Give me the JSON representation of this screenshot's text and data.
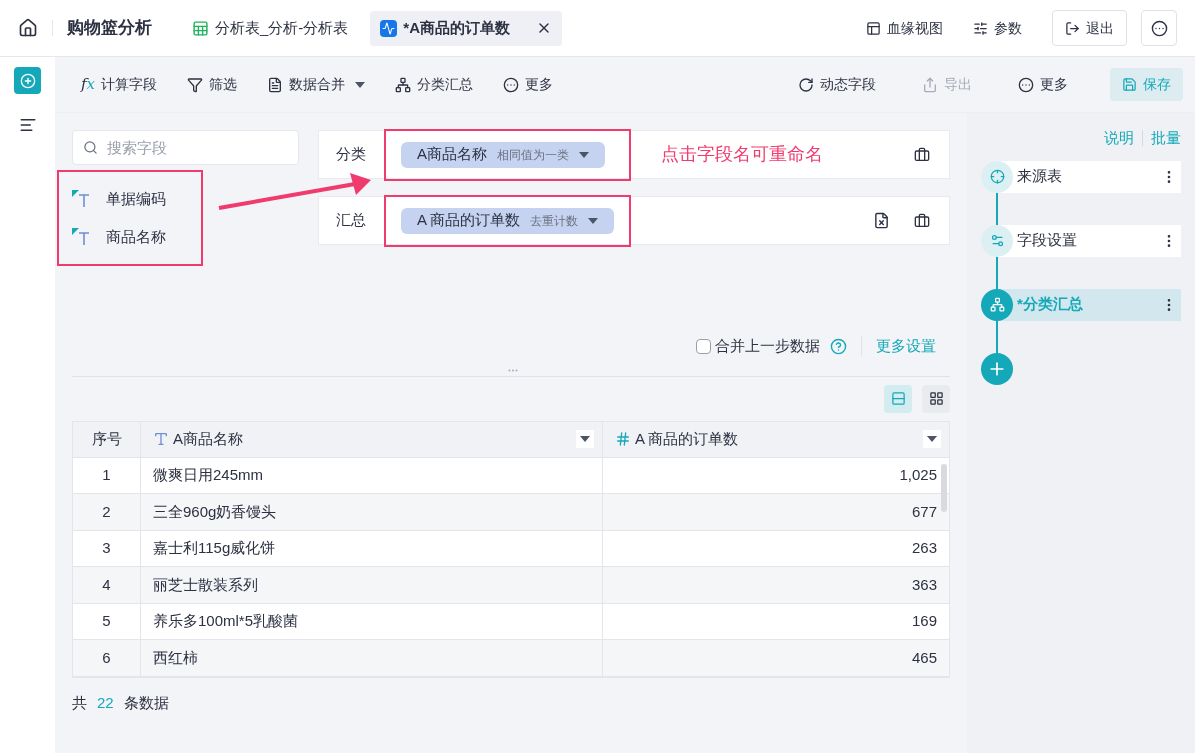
{
  "header": {
    "title": "购物篮分析",
    "tabs": [
      {
        "kind": "sheet",
        "label": "分析表_分析-分析表",
        "selected": false
      },
      {
        "kind": "chart",
        "label": "*A商品的订单数",
        "selected": true
      }
    ],
    "actions": [
      {
        "kind": "lineage",
        "label": "血缘视图"
      },
      {
        "kind": "params",
        "label": "参数"
      }
    ],
    "exit": "退出"
  },
  "toolbar": {
    "left": [
      {
        "kind": "fx",
        "glyph": "fx",
        "label": "计算字段",
        "dropdown": false
      },
      {
        "kind": "filter",
        "label": "筛选",
        "dropdown": false
      },
      {
        "kind": "merge",
        "label": "数据合并",
        "dropdown": true
      },
      {
        "kind": "group",
        "label": "分类汇总",
        "dropdown": false
      },
      {
        "kind": "more",
        "label": "更多",
        "dropdown": false
      }
    ],
    "right": [
      {
        "kind": "dynamic",
        "label": "动态字段",
        "disabled": false
      },
      {
        "kind": "export",
        "label": "导出",
        "disabled": true
      },
      {
        "kind": "more",
        "label": "更多",
        "disabled": false
      }
    ],
    "save": "保存"
  },
  "search": {
    "placeholder": "搜索字段"
  },
  "fields": [
    "单据编码",
    "商品名称"
  ],
  "config": [
    {
      "label": "分类",
      "chip": "A商品名称",
      "mode": "相同值为一类",
      "clearable": false
    },
    {
      "label": "汇总",
      "chip": "A 商品的订单数",
      "mode": "去重计数",
      "clearable": true
    }
  ],
  "hint": "点击字段名可重命名",
  "merge": {
    "label": "合并上一步数据",
    "checked": false
  },
  "more_settings": "更多设置",
  "view_modes": [
    {
      "kind": "list",
      "selected": true
    },
    {
      "kind": "grid",
      "selected": false
    }
  ],
  "table": {
    "columns": [
      {
        "kind": "index",
        "label": "序号"
      },
      {
        "kind": "text",
        "label": "A商品名称"
      },
      {
        "kind": "number",
        "label": "A 商品的订单数"
      }
    ],
    "rows": [
      [
        "1",
        "微爽日用245mm",
        "1,025"
      ],
      [
        "2",
        "三全960g奶香馒头",
        "677"
      ],
      [
        "3",
        "嘉士利115g威化饼",
        "263"
      ],
      [
        "4",
        "丽芝士散装系列",
        "363"
      ],
      [
        "5",
        "养乐多100ml*5乳酸菌",
        "169"
      ],
      [
        "6",
        "西红柿",
        "465"
      ]
    ]
  },
  "footer": {
    "prefix": "共",
    "count": "22",
    "suffix": "条数据"
  },
  "steps": {
    "links": [
      "说明",
      "批量"
    ],
    "items": [
      {
        "kind": "source",
        "label": "来源表",
        "selected": false
      },
      {
        "kind": "fields",
        "label": "字段设置",
        "selected": false
      },
      {
        "kind": "group",
        "label": "*分类汇总",
        "selected": true
      }
    ]
  }
}
